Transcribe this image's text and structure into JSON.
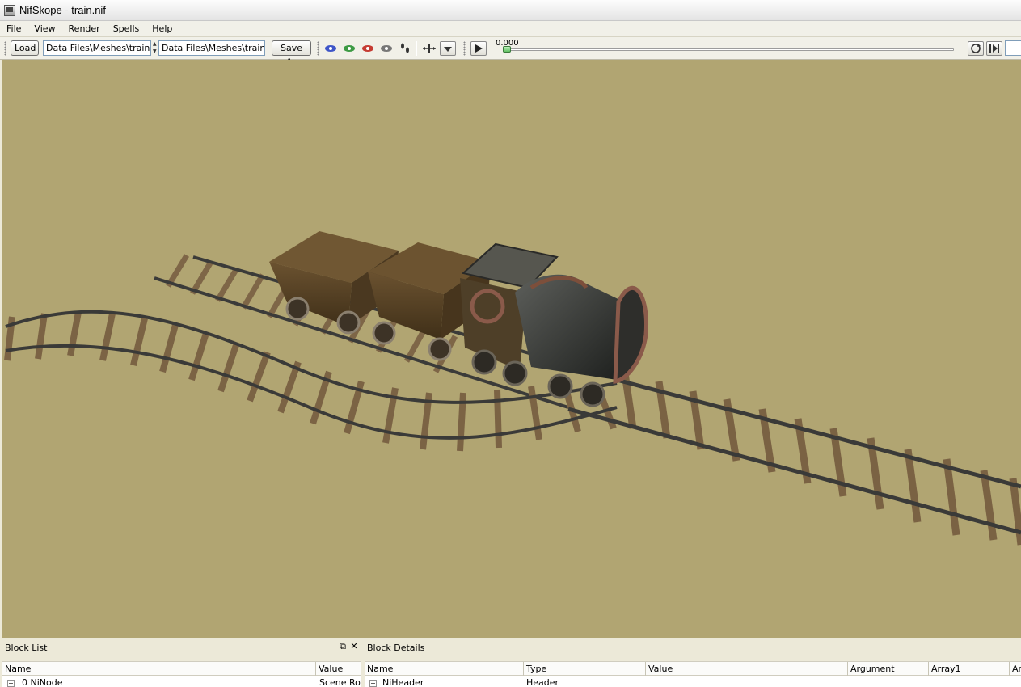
{
  "window": {
    "title": "NifSkope - train.nif"
  },
  "menu": {
    "items": [
      "File",
      "View",
      "Render",
      "Spells",
      "Help"
    ]
  },
  "toolbar": {
    "load_label": "Load",
    "load_path": "Data Files\\Meshes\\train.nif",
    "save_path": "Data Files\\Meshes\\train.nif",
    "save_as_label": "Save As",
    "time_value": "0.000",
    "time_progress": 0.0
  },
  "block_list": {
    "title": "Block List",
    "columns": [
      "Name",
      "Value"
    ],
    "rows": [
      {
        "name": "0 NiNode",
        "value": "Scene Roo"
      }
    ]
  },
  "block_details": {
    "title": "Block Details",
    "columns": [
      "Name",
      "Type",
      "Value",
      "Argument",
      "Array1",
      "Ar"
    ],
    "rows": [
      {
        "name": "NiHeader",
        "type": "Header"
      }
    ]
  },
  "colors": {
    "viewport_bg": "#b1a572",
    "menu_bg": "#f1f0e8",
    "rail": "#3b3b39",
    "tie": "#7b6344",
    "wagon": "#5a4526"
  }
}
